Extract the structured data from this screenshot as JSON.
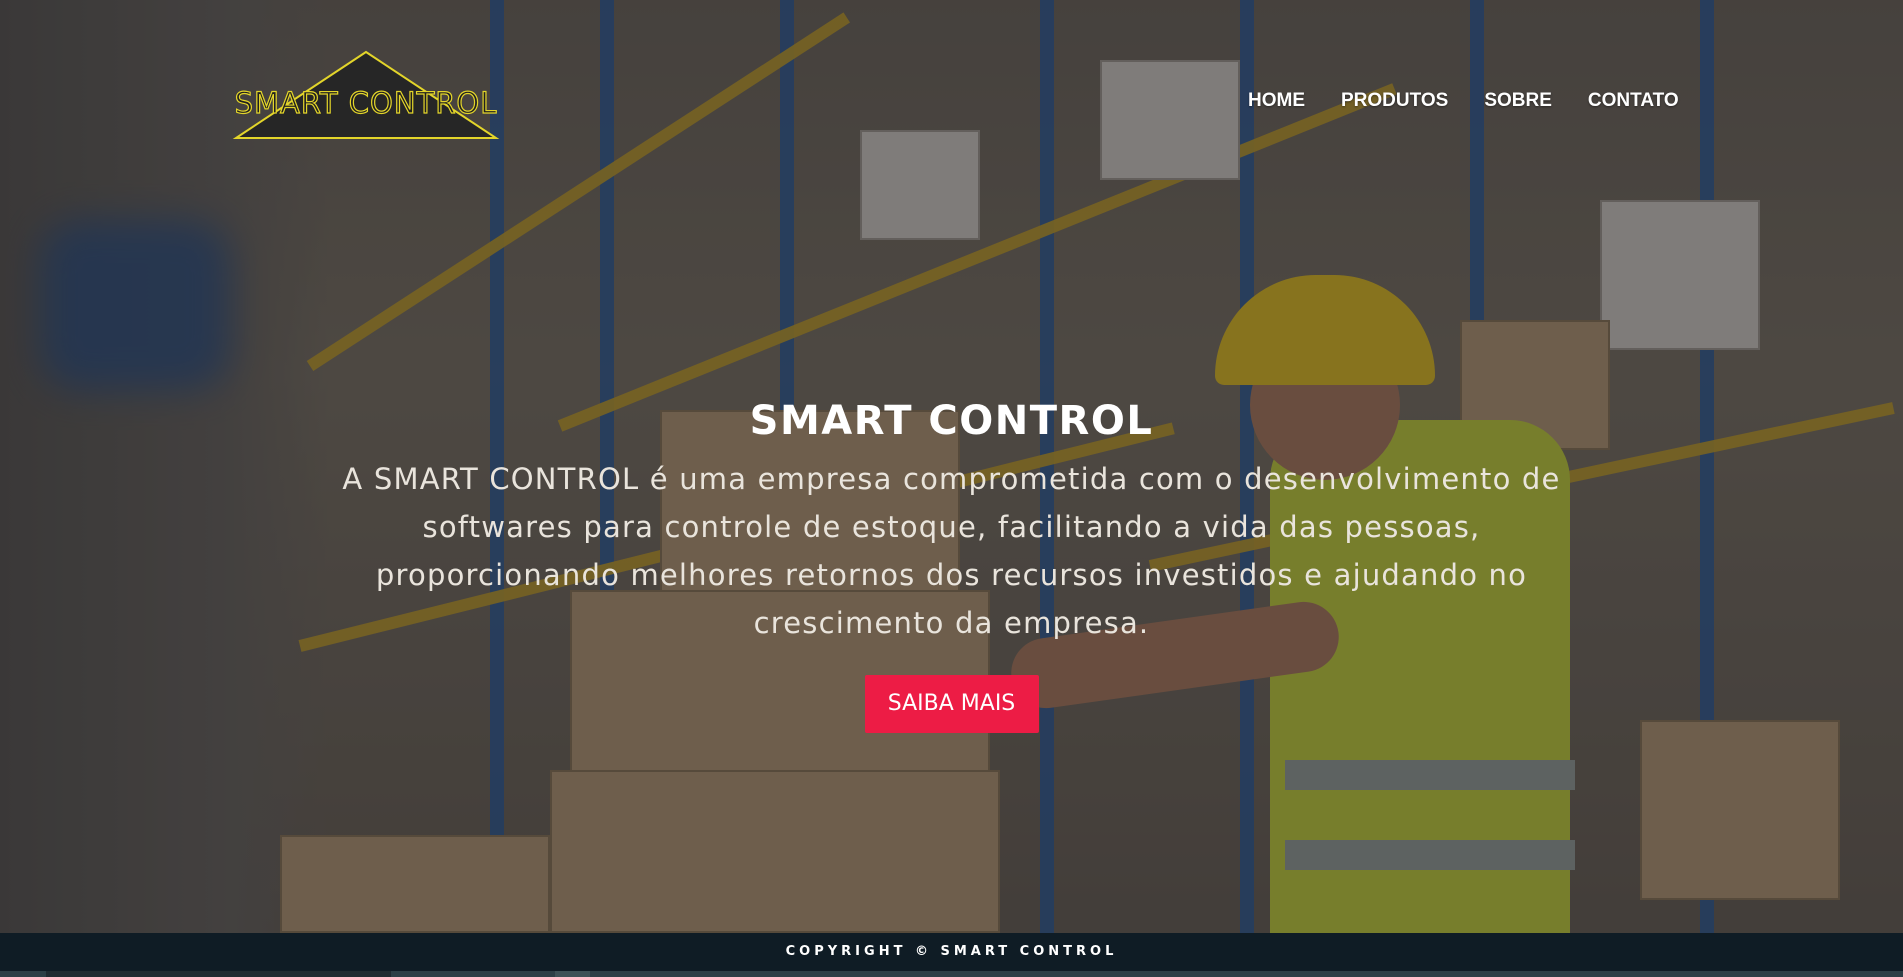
{
  "brand": {
    "logo_text": "SMART CONTROL",
    "logo_color": "#e3d52a"
  },
  "nav": {
    "items": [
      {
        "label": "HOME"
      },
      {
        "label": "PRODUTOS"
      },
      {
        "label": "SOBRE"
      },
      {
        "label": "CONTATO"
      }
    ]
  },
  "hero": {
    "title": "SMART CONTROL",
    "description": "A SMART CONTROL é uma empresa comprometida com o desenvolvimento de softwares para controle de estoque, facilitando a vida das pessoas, proporcionando melhores retornos dos recursos investidos e ajudando no crescimento da empresa.",
    "cta_label": "SAIBA MAIS",
    "cta_color": "#ed1c45"
  },
  "footer": {
    "copyright": "COPYRIGHT © SMART CONTROL"
  }
}
